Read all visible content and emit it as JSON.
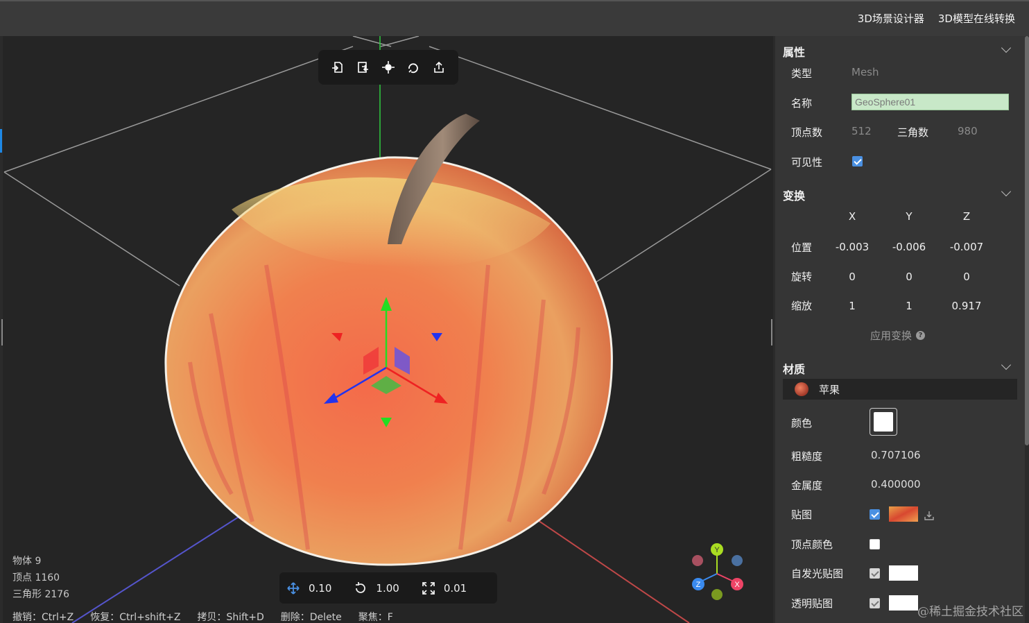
{
  "header": {
    "links": [
      "3D场景设计器",
      "3D模型在线转换"
    ]
  },
  "viewport": {
    "stats": {
      "objects": "物体 9",
      "vertices": "顶点 1160",
      "triangles": "三角形 2176"
    },
    "snap": {
      "translate": "0.10",
      "rotate": "1.00",
      "scale": "0.01"
    },
    "shortcuts": [
      "撤销：Ctrl+Z",
      "恢复：Ctrl+shift+Z",
      "拷贝：Shift+D",
      "删除：Delete",
      "聚焦：F"
    ],
    "gizmo_axes": {
      "y": "Y",
      "z": "Z",
      "x": "X"
    },
    "toolbar_icons": [
      "import-icon",
      "replace-icon",
      "focus-icon",
      "reset-icon",
      "export-icon"
    ]
  },
  "panel": {
    "properties": {
      "title": "属性",
      "type_label": "类型",
      "type_value": "Mesh",
      "name_label": "名称",
      "name_value": "GeoSphere01",
      "vertices_label": "顶点数",
      "vertices_value": "512",
      "triangles_label": "三角数",
      "triangles_value": "980",
      "visible_label": "可见性",
      "visible": true
    },
    "transform": {
      "title": "变换",
      "axes": [
        "X",
        "Y",
        "Z"
      ],
      "position_label": "位置",
      "position": [
        "-0.003",
        "-0.006",
        "-0.007"
      ],
      "rotation_label": "旋转",
      "rotation": [
        "0",
        "0",
        "0"
      ],
      "scale_label": "缩放",
      "scale": [
        "1",
        "1",
        "0.917"
      ],
      "apply_label": "应用变换"
    },
    "material": {
      "title": "材质",
      "item_name": "苹果",
      "color_label": "颜色",
      "color": "#ffffff",
      "roughness_label": "粗糙度",
      "roughness": "0.707106",
      "metalness_label": "金属度",
      "metalness": "0.400000",
      "map_label": "贴图",
      "map_enabled": true,
      "vertex_color_label": "顶点颜色",
      "vertex_color": false,
      "emissive_map_label": "自发光贴图",
      "emissive_map": true,
      "alpha_map_label": "透明贴图",
      "alpha_map": true
    }
  },
  "watermark": "@稀土掘金技术社区",
  "colors": {
    "accent": "#4a90e2",
    "name_field": "#c8e8c8",
    "panel": "#353535",
    "viewport": "#252525"
  }
}
